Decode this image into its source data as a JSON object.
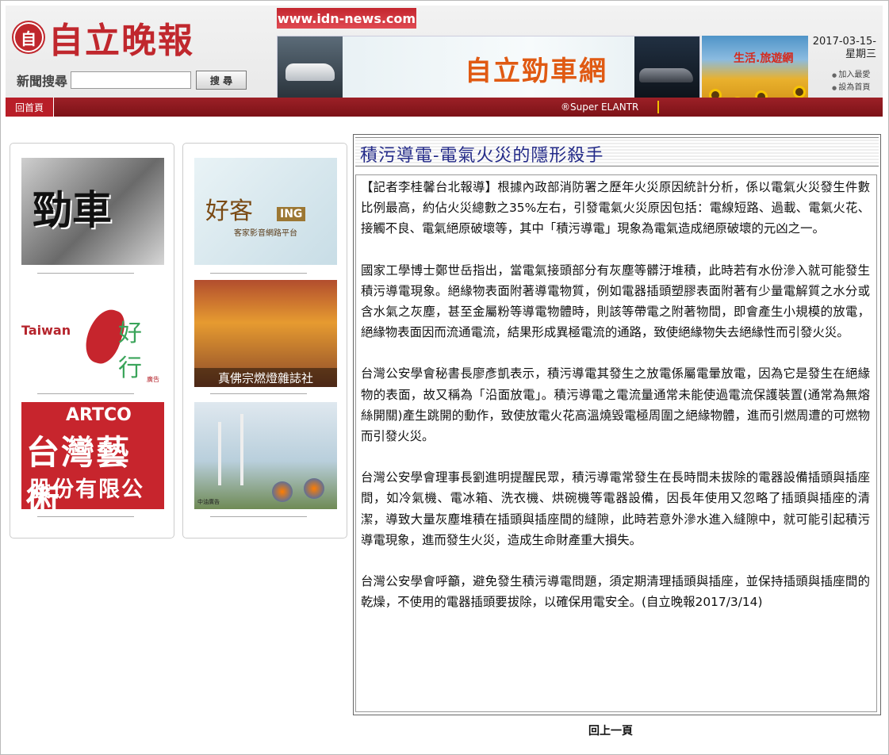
{
  "header": {
    "logo_text": "自立晚報",
    "logo_mark": "自",
    "site_url": "www.idn-news.com",
    "search_label": "新聞搜尋",
    "search_value": "",
    "search_button": "搜 尋",
    "car_banner_title": "自立勁車網",
    "travel_banner_title": "生活.旅遊網",
    "date": "2017-03-15-",
    "weekday": "星期三",
    "quick_links": [
      "加入最愛",
      "設為首頁"
    ]
  },
  "nav": {
    "home": "回首頁",
    "ticker": "®Super ELANTR"
  },
  "ads_left": {
    "car_ad": "勁車",
    "taiwan_en": "Taiwan",
    "taiwan_cn": "好行",
    "taiwan_tag": "廣告",
    "art_logo": "ARTCO",
    "art_line1": "台灣藝術",
    "art_line2": "股份有限公司"
  },
  "ads_right": {
    "hakka_cn": "好客",
    "hakka_ing": "ING",
    "hakka_sub": "客家影音網路平台",
    "temple_caption": "真佛宗燃燈雜誌社",
    "factory_label": "中油廣告"
  },
  "article": {
    "title": "積污導電-電氣火災的隱形殺手",
    "paragraphs": [
      "【記者李桂馨台北報導】根據內政部消防署之歷年火災原因統計分析，係以電氣火災發生件數比例最高，約佔火災總數之35%左右，引發電氣火災原因包括：電線短路、過載、電氣火花、接觸不良、電氣絕原破壞等，其中「積污導電」現象為電氣造成絕原破壞的元凶之一。",
      "國家工學博士鄭世岳指出，當電氣接頭部分有灰塵等髒汙堆積，此時若有水份滲入就可能發生積污導電現象。絕緣物表面附著導電物質，例如電器插頭塑膠表面附著有少量電解質之水分或含水氣之灰塵，甚至金屬粉等導電物體時，則該等帶電之附著物間，即會產生小規模的放電，絕緣物表面因而流通電流，結果形成異極電流的通路，致使絕緣物失去絕緣性而引發火災。",
      "台灣公安學會秘書長廖彥凱表示，積污導電其發生之放電係屬電暈放電，因為它是發生在絕緣物的表面，故又稱為「沿面放電」。積污導電之電流量通常未能使過電流保護裝置(通常為無熔絲開關)產生跳開的動作，致使放電火花高溫燒毀電極周圍之絕緣物體，進而引燃周遭的可燃物而引發火災。",
      "台灣公安學會理事長劉進明提醒民眾，積污導電常發生在長時間未拔除的電器設備插頭與插座間，如冷氣機、電冰箱、洗衣機、烘碗機等電器設備，因長年使用又忽略了插頭與插座的清潔，導致大量灰塵堆積在插頭與插座間的縫隙，此時若意外滲水進入縫隙中，就可能引起積污導電現象，進而發生火災，造成生命財產重大損失。",
      "台灣公安學會呼籲，避免發生積污導電問題，須定期清理插頭與插座，並保持插頭與插座間的乾燥，不使用的電器插頭要拔除，以確保用電安全。(自立晚報2017/3/14)"
    ]
  },
  "footer": {
    "back_link": "回上一頁"
  }
}
